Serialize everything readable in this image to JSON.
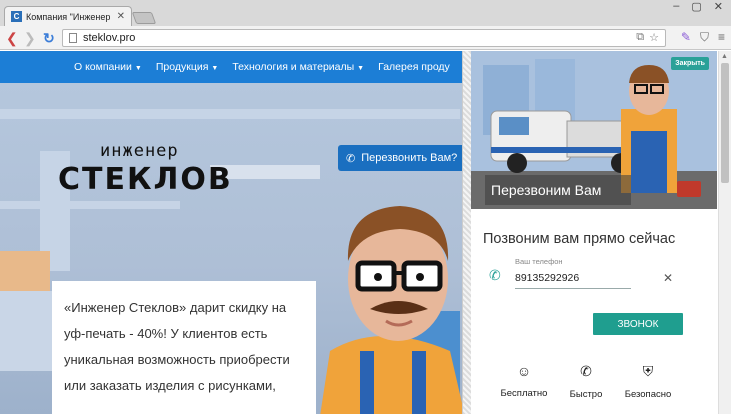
{
  "browser": {
    "tab_title": "Компания \"Инженер С",
    "tab_favicon_letter": "С",
    "url": "steklov.pro",
    "window_controls": [
      "–",
      "▢",
      "✕"
    ]
  },
  "site": {
    "nav": [
      {
        "label": "О компании"
      },
      {
        "label": "Продукция"
      },
      {
        "label": "Технология и материалы"
      },
      {
        "label": "Галерея проду"
      }
    ],
    "logo_top": "инженер",
    "logo_bottom": "СТЕКЛОВ",
    "callback_button": "Перезвонить Вам?",
    "promo_text": "«Инженер Стеклов» дарит скидку на уф-печать - 40%! У клиентов есть уникальная возможность приобрести или заказать изделия с рисунками,"
  },
  "widget": {
    "close_label": "Закрыть",
    "hero_title": "Перезвоним Вам",
    "heading": "Позвоним вам прямо сейчас",
    "phone_label": "Ваш телефон",
    "phone_value": "89135292926",
    "submit_label": "ЗВОНОК",
    "features": [
      {
        "icon": "smile-icon",
        "label": "Бесплатно"
      },
      {
        "icon": "phone-fast-icon",
        "label": "Быстро"
      },
      {
        "icon": "shield-check-icon",
        "label": "Безопасно"
      }
    ],
    "accent_color": "#1f9e8f"
  },
  "colors": {
    "navbar": "#1c7ed6",
    "callback_button": "#1a6fc0"
  }
}
